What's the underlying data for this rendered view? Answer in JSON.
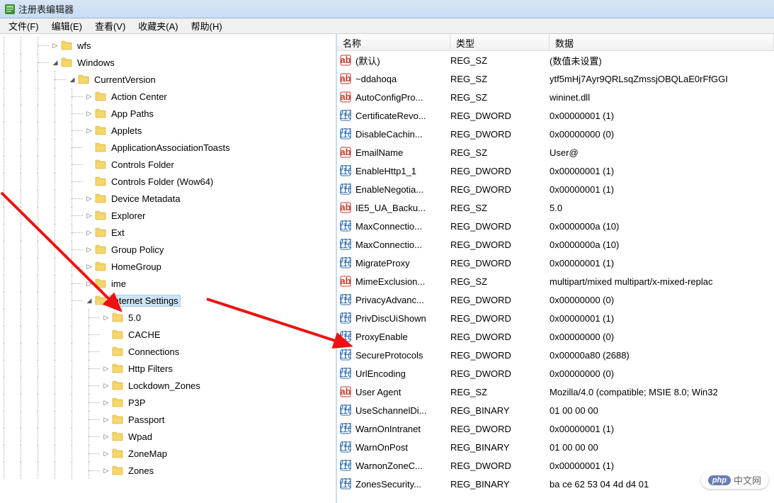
{
  "window": {
    "title": "注册表编辑器"
  },
  "menu": {
    "file": "文件(F)",
    "edit": "编辑(E)",
    "view": "查看(V)",
    "favorites": "收藏夹(A)",
    "help": "帮助(H)"
  },
  "tree": [
    {
      "indent": 3,
      "expand": "closed",
      "label": "wfs"
    },
    {
      "indent": 3,
      "expand": "open",
      "label": "Windows"
    },
    {
      "indent": 4,
      "expand": "open",
      "label": "CurrentVersion"
    },
    {
      "indent": 5,
      "expand": "closed",
      "label": "Action Center"
    },
    {
      "indent": 5,
      "expand": "closed",
      "label": "App Paths"
    },
    {
      "indent": 5,
      "expand": "closed",
      "label": "Applets"
    },
    {
      "indent": 5,
      "expand": "none",
      "label": "ApplicationAssociationToasts"
    },
    {
      "indent": 5,
      "expand": "none",
      "label": "Controls Folder"
    },
    {
      "indent": 5,
      "expand": "none",
      "label": "Controls Folder (Wow64)"
    },
    {
      "indent": 5,
      "expand": "closed",
      "label": "Device Metadata"
    },
    {
      "indent": 5,
      "expand": "closed",
      "label": "Explorer"
    },
    {
      "indent": 5,
      "expand": "closed",
      "label": "Ext"
    },
    {
      "indent": 5,
      "expand": "closed",
      "label": "Group Policy"
    },
    {
      "indent": 5,
      "expand": "closed",
      "label": "HomeGroup"
    },
    {
      "indent": 5,
      "expand": "closed",
      "label": "ime"
    },
    {
      "indent": 5,
      "expand": "open",
      "label": "Internet Settings",
      "selected": true
    },
    {
      "indent": 6,
      "expand": "closed",
      "label": "5.0"
    },
    {
      "indent": 6,
      "expand": "none",
      "label": "CACHE"
    },
    {
      "indent": 6,
      "expand": "none",
      "label": "Connections"
    },
    {
      "indent": 6,
      "expand": "closed",
      "label": "Http Filters"
    },
    {
      "indent": 6,
      "expand": "closed",
      "label": "Lockdown_Zones"
    },
    {
      "indent": 6,
      "expand": "closed",
      "label": "P3P"
    },
    {
      "indent": 6,
      "expand": "closed",
      "label": "Passport"
    },
    {
      "indent": 6,
      "expand": "closed",
      "label": "Wpad"
    },
    {
      "indent": 6,
      "expand": "closed",
      "label": "ZoneMap"
    },
    {
      "indent": 6,
      "expand": "closed",
      "label": "Zones"
    }
  ],
  "columns": {
    "name": "名称",
    "type": "类型",
    "data": "数据"
  },
  "values": [
    {
      "icon": "sz",
      "name": "(默认)",
      "type": "REG_SZ",
      "data": "(数值未设置)"
    },
    {
      "icon": "sz",
      "name": "~ddahoqa",
      "type": "REG_SZ",
      "data": "ytf5mHj7Ayr9QRLsqZmssjOBQLaE0rFfGGI"
    },
    {
      "icon": "sz",
      "name": "AutoConfigPro...",
      "type": "REG_SZ",
      "data": "wininet.dll"
    },
    {
      "icon": "dw",
      "name": "CertificateRevo...",
      "type": "REG_DWORD",
      "data": "0x00000001 (1)"
    },
    {
      "icon": "dw",
      "name": "DisableCachin...",
      "type": "REG_DWORD",
      "data": "0x00000000 (0)"
    },
    {
      "icon": "sz",
      "name": "EmailName",
      "type": "REG_SZ",
      "data": "User@"
    },
    {
      "icon": "dw",
      "name": "EnableHttp1_1",
      "type": "REG_DWORD",
      "data": "0x00000001 (1)"
    },
    {
      "icon": "dw",
      "name": "EnableNegotia...",
      "type": "REG_DWORD",
      "data": "0x00000001 (1)"
    },
    {
      "icon": "sz",
      "name": "IE5_UA_Backu...",
      "type": "REG_SZ",
      "data": "5.0"
    },
    {
      "icon": "dw",
      "name": "MaxConnectio...",
      "type": "REG_DWORD",
      "data": "0x0000000a (10)"
    },
    {
      "icon": "dw",
      "name": "MaxConnectio...",
      "type": "REG_DWORD",
      "data": "0x0000000a (10)"
    },
    {
      "icon": "dw",
      "name": "MigrateProxy",
      "type": "REG_DWORD",
      "data": "0x00000001 (1)"
    },
    {
      "icon": "sz",
      "name": "MimeExclusion...",
      "type": "REG_SZ",
      "data": "multipart/mixed multipart/x-mixed-replac"
    },
    {
      "icon": "dw",
      "name": "PrivacyAdvanc...",
      "type": "REG_DWORD",
      "data": "0x00000000 (0)"
    },
    {
      "icon": "dw",
      "name": "PrivDiscUiShown",
      "type": "REG_DWORD",
      "data": "0x00000001 (1)"
    },
    {
      "icon": "dw",
      "name": "ProxyEnable",
      "type": "REG_DWORD",
      "data": "0x00000000 (0)"
    },
    {
      "icon": "dw",
      "name": "SecureProtocols",
      "type": "REG_DWORD",
      "data": "0x00000a80 (2688)"
    },
    {
      "icon": "dw",
      "name": "UrlEncoding",
      "type": "REG_DWORD",
      "data": "0x00000000 (0)"
    },
    {
      "icon": "sz",
      "name": "User Agent",
      "type": "REG_SZ",
      "data": "Mozilla/4.0 (compatible; MSIE 8.0; Win32"
    },
    {
      "icon": "dw",
      "name": "UseSchannelDi...",
      "type": "REG_BINARY",
      "data": "01 00 00 00"
    },
    {
      "icon": "dw",
      "name": "WarnOnIntranet",
      "type": "REG_DWORD",
      "data": "0x00000001 (1)"
    },
    {
      "icon": "dw",
      "name": "WarnOnPost",
      "type": "REG_BINARY",
      "data": "01 00 00 00"
    },
    {
      "icon": "dw",
      "name": "WarnonZoneC...",
      "type": "REG_DWORD",
      "data": "0x00000001 (1)"
    },
    {
      "icon": "dw",
      "name": "ZonesSecurity...",
      "type": "REG_BINARY",
      "data": "ba ce 62 53 04 4d d4 01"
    }
  ],
  "watermark": {
    "brand": "php",
    "text": "中文网"
  }
}
